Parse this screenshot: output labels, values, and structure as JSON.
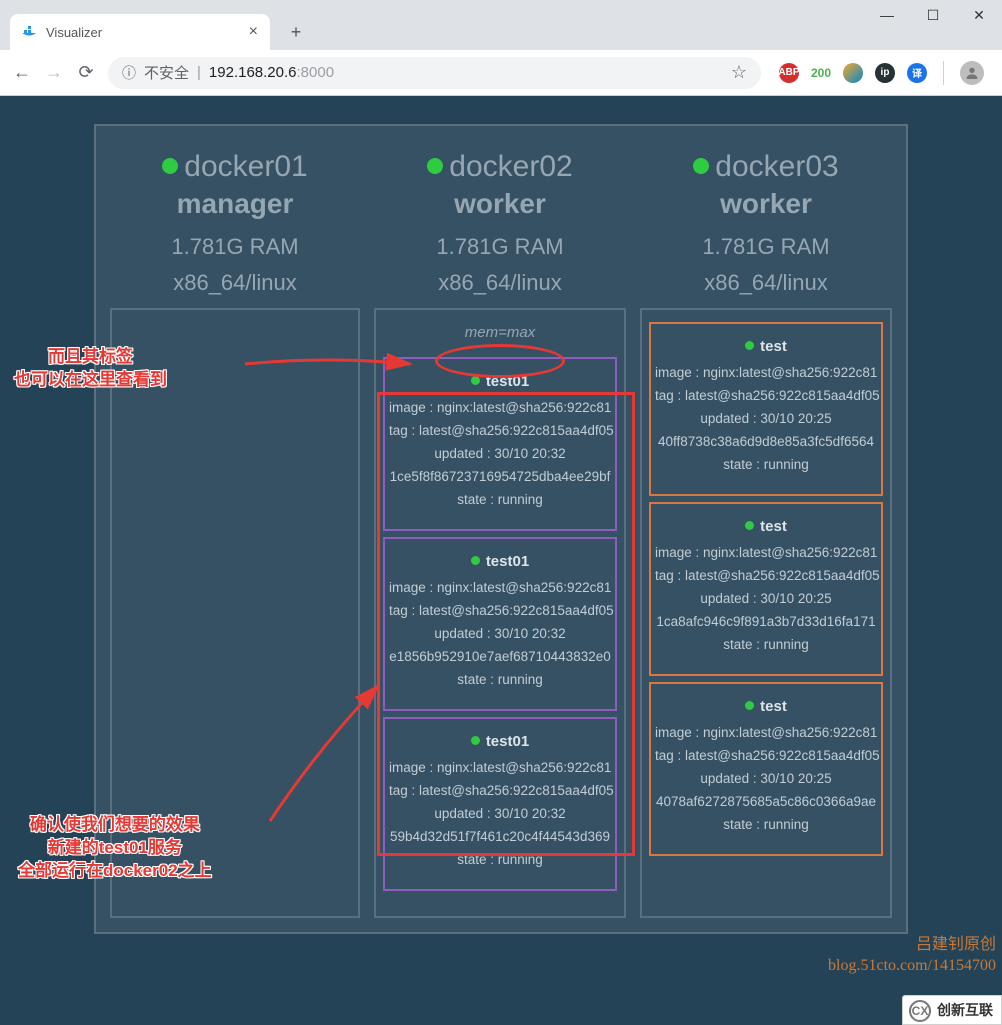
{
  "browser": {
    "tab_title": "Visualizer",
    "insecure_label": "不安全",
    "url_host": "192.168.20.6",
    "url_port": ":8000"
  },
  "annotations": {
    "top_l1": "而且其标签",
    "top_l2": "也可以在这里查看到",
    "bottom_l1": "确认使我们想要的效果",
    "bottom_l2": "新建的test01服务",
    "bottom_l3": "全部运行在docker02之上"
  },
  "nodes": [
    {
      "name": "docker01",
      "role": "manager",
      "ram": "1.781G RAM",
      "arch": "x86_64/linux",
      "tags": [],
      "services": []
    },
    {
      "name": "docker02",
      "role": "worker",
      "ram": "1.781G RAM",
      "arch": "x86_64/linux",
      "tags": [
        "mem=max"
      ],
      "services": [
        {
          "color": "purple",
          "title": "test01",
          "image": "image : nginx:latest@sha256:922c81",
          "tag": "tag : latest@sha256:922c815aa4df05",
          "updated": "updated : 30/10 20:32",
          "hash": "1ce5f8f86723716954725dba4ee29bf",
          "state": "state : running"
        },
        {
          "color": "purple",
          "title": "test01",
          "image": "image : nginx:latest@sha256:922c81",
          "tag": "tag : latest@sha256:922c815aa4df05",
          "updated": "updated : 30/10 20:32",
          "hash": "e1856b952910e7aef68710443832e0",
          "state": "state : running"
        },
        {
          "color": "purple",
          "title": "test01",
          "image": "image : nginx:latest@sha256:922c81",
          "tag": "tag : latest@sha256:922c815aa4df05",
          "updated": "updated : 30/10 20:32",
          "hash": "59b4d32d51f7f461c20c4f44543d369",
          "state": "state : running"
        }
      ]
    },
    {
      "name": "docker03",
      "role": "worker",
      "ram": "1.781G RAM",
      "arch": "x86_64/linux",
      "tags": [],
      "services": [
        {
          "color": "orange",
          "title": "test",
          "image": "image : nginx:latest@sha256:922c81",
          "tag": "tag : latest@sha256:922c815aa4df05",
          "updated": "updated : 30/10 20:25",
          "hash": "40ff8738c38a6d9d8e85a3fc5df6564",
          "state": "state : running"
        },
        {
          "color": "orange",
          "title": "test",
          "image": "image : nginx:latest@sha256:922c81",
          "tag": "tag : latest@sha256:922c815aa4df05",
          "updated": "updated : 30/10 20:25",
          "hash": "1ca8afc946c9f891a3b7d33d16fa171",
          "state": "state : running"
        },
        {
          "color": "orange",
          "title": "test",
          "image": "image : nginx:latest@sha256:922c81",
          "tag": "tag : latest@sha256:922c815aa4df05",
          "updated": "updated : 30/10 20:25",
          "hash": "4078af6272875685a5c86c0366a9ae",
          "state": "state : running"
        }
      ]
    }
  ],
  "watermarks": {
    "w1_l1": "吕建钊原创",
    "w1_l2": "blog.51cto.com/14154700",
    "w2": "创新互联"
  }
}
